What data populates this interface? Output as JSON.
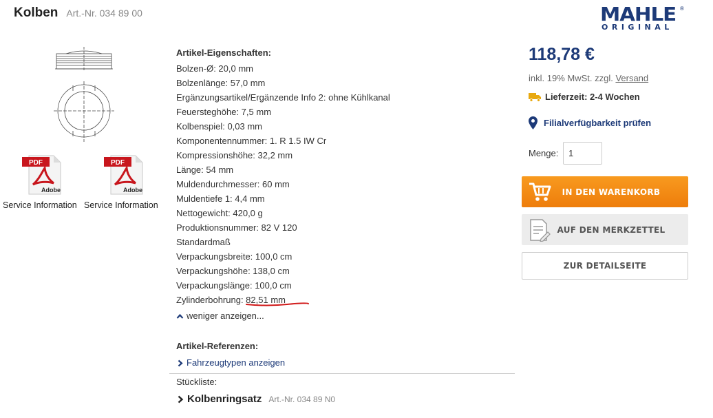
{
  "product": {
    "name": "Kolben",
    "art_nr": "Art.-Nr. 034 89 00"
  },
  "brand": {
    "name": "MAHLE",
    "sub": "ORIGINAL",
    "reg": "®",
    "color": "#1d3a78"
  },
  "documents": [
    {
      "icon": "pdf-adobe-icon",
      "badge": "PDF",
      "vendor": "Adobe",
      "caption": "Service Information"
    },
    {
      "icon": "pdf-adobe-icon",
      "badge": "PDF",
      "vendor": "Adobe",
      "caption": "Service Information"
    }
  ],
  "properties": {
    "title": "Artikel-Eigenschaften:",
    "items": [
      "Bolzen-Ø: 20,0 mm",
      "Bolzenlänge: 57,0 mm",
      "Ergänzungsartikel/Ergänzende Info 2: ohne Kühlkanal",
      "Feuersteghöhe: 7,5 mm",
      "Kolbenspiel: 0,03 mm",
      "Komponentennummer: 1. R 1.5 IW Cr",
      "Kompressionshöhe: 32,2 mm",
      "Länge: 54 mm",
      "Muldendurchmesser: 60 mm",
      "Muldentiefe 1: 4,4 mm",
      "Nettogewicht: 420,0 g",
      "Produktionsnummer: 82 V 120",
      "Standardmaß",
      "Verpackungsbreite: 100,0 cm",
      "Verpackungshöhe: 138,0 cm",
      "Verpackungslänge: 100,0 cm"
    ],
    "highlight_label": "Zylinderbohrung: ",
    "highlight_value": "82,51 mm",
    "toggle_label": "weniger anzeigen..."
  },
  "references": {
    "title": "Artikel-Referenzen:",
    "link": "Fahrzeugtypen anzeigen"
  },
  "bom": {
    "label": "Stückliste:",
    "item_name": "Kolbenringsatz",
    "item_art_nr": "Art.-Nr. 034 89 N0"
  },
  "purchase": {
    "price": "118,78 €",
    "tax_prefix": "inkl. 19% MwSt. zzgl. ",
    "shipping_link": "Versand",
    "delivery": "Lieferzeit: 2-4 Wochen",
    "branch_check": "Filialverfügbarkeit prüfen",
    "qty_label": "Menge:",
    "qty_value": "1",
    "cart_button": "IN DEN WARENKORB",
    "wishlist_button": "AUF DEN MERKZETTEL",
    "detail_button": "ZUR DETAILSEITE",
    "accent_color": "#f08310",
    "truck_color": "#e8a911"
  }
}
